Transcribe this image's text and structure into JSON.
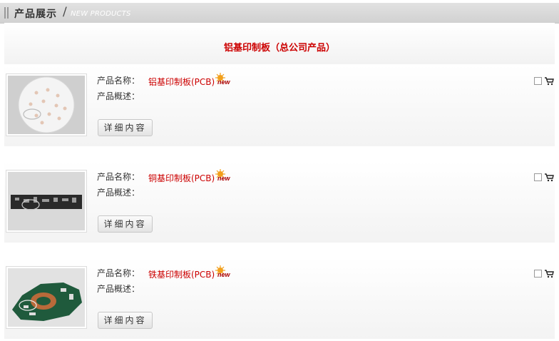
{
  "header": {
    "title": "产品展示",
    "slash": "/",
    "subtitle": "NEW PRODUCTS"
  },
  "page_title": "铝基印制板（总公司产品）",
  "labels": {
    "name": "产品名称：",
    "desc": "产品概述："
  },
  "detail_button": "详细内容",
  "new_badge": "new",
  "products": [
    {
      "name": "铝基印制板(PCB)",
      "description": ""
    },
    {
      "name": "铜基印制板(PCB)",
      "description": ""
    },
    {
      "name": "铁基印制板(PCB)",
      "description": ""
    }
  ],
  "colors": {
    "accent_red": "#cc0000",
    "header_bg": "#d8d8d8"
  }
}
